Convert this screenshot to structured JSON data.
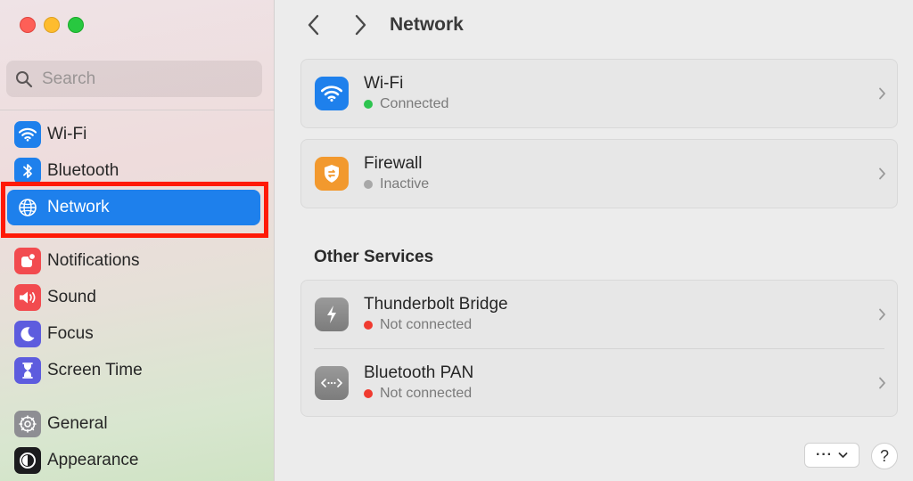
{
  "window": {
    "traffic_lights": [
      "close",
      "minimize",
      "zoom"
    ]
  },
  "sidebar": {
    "search": {
      "placeholder": "Search",
      "value": ""
    },
    "items": [
      {
        "label": "Wi-Fi",
        "icon": "wifi-icon",
        "color": "#1e80ec",
        "selected": false
      },
      {
        "label": "Bluetooth",
        "icon": "bluetooth-icon",
        "color": "#1e80ec",
        "selected": false
      },
      {
        "label": "Network",
        "icon": "globe-icon",
        "color": "#1e80ec",
        "selected": true
      },
      {
        "label": "Notifications",
        "icon": "bell-icon",
        "color": "#f24b4f",
        "selected": false
      },
      {
        "label": "Sound",
        "icon": "speaker-icon",
        "color": "#f24b4f",
        "selected": false
      },
      {
        "label": "Focus",
        "icon": "moon-icon",
        "color": "#5d5cde",
        "selected": false
      },
      {
        "label": "Screen Time",
        "icon": "hourglass-icon",
        "color": "#5d5cde",
        "selected": false
      },
      {
        "label": "General",
        "icon": "gear-icon",
        "color": "#8e8e93",
        "selected": false
      },
      {
        "label": "Appearance",
        "icon": "appearance-icon",
        "color": "#1c1c1e",
        "selected": false
      }
    ]
  },
  "main": {
    "title": "Network",
    "services": [
      {
        "name": "Wi-Fi",
        "status": "Connected",
        "status_color": "#2dc44f",
        "icon": "wifi-icon",
        "icon_color": "#1e80ec"
      },
      {
        "name": "Firewall",
        "status": "Inactive",
        "status_color": "#a8a8a8",
        "icon": "firewall-icon",
        "icon_color": "#f2992e"
      }
    ],
    "other_services_title": "Other Services",
    "other_services": [
      {
        "name": "Thunderbolt Bridge",
        "status": "Not connected",
        "status_color": "#f03a2f",
        "icon": "thunderbolt-icon",
        "icon_color": "#8a8a8a"
      },
      {
        "name": "Bluetooth PAN",
        "status": "Not connected",
        "status_color": "#f03a2f",
        "icon": "bluetooth-pan-icon",
        "icon_color": "#8a8a8a"
      }
    ],
    "more_button": "···",
    "help_button": "?"
  },
  "colors": {
    "accent": "#1e80ec",
    "highlight_box": "#ff1a06"
  }
}
